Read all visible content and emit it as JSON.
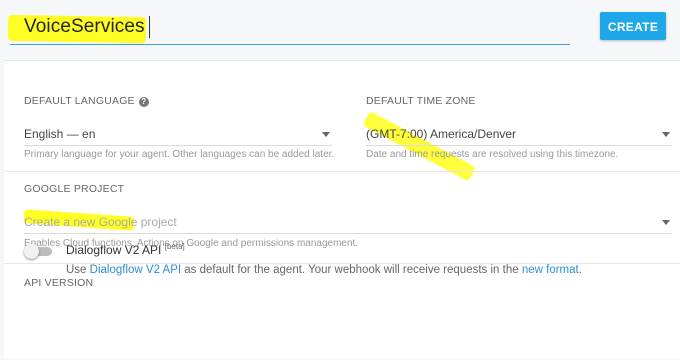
{
  "header": {
    "agent_name": "VoiceServices",
    "create_label": "CREATE"
  },
  "language": {
    "label": "DEFAULT LANGUAGE",
    "value": "English — en",
    "hint": "Primary language for your agent. Other languages can be added later."
  },
  "timezone": {
    "label": "DEFAULT TIME ZONE",
    "value": "(GMT-7:00) America/Denver",
    "hint": "Date and time requests are resolved using this timezone."
  },
  "project": {
    "label": "GOOGLE PROJECT",
    "placeholder": "Create a new Google project",
    "hint": "Enables Cloud functions, Actions on Google and permissions management."
  },
  "api": {
    "label": "API VERSION",
    "title": "Dialogflow V2 API",
    "badge": "[beta]",
    "desc_prefix": "Use ",
    "desc_link1": "Dialogflow V2 API",
    "desc_middle": " as default for the agent. Your webhook will receive requests in the ",
    "desc_link2": "new format",
    "desc_suffix": ".",
    "enabled": false
  },
  "colors": {
    "accent": "#1ea7e9",
    "highlight": "#ffff00"
  },
  "icons": [
    "help-icon",
    "dropdown-arrow-icon"
  ]
}
